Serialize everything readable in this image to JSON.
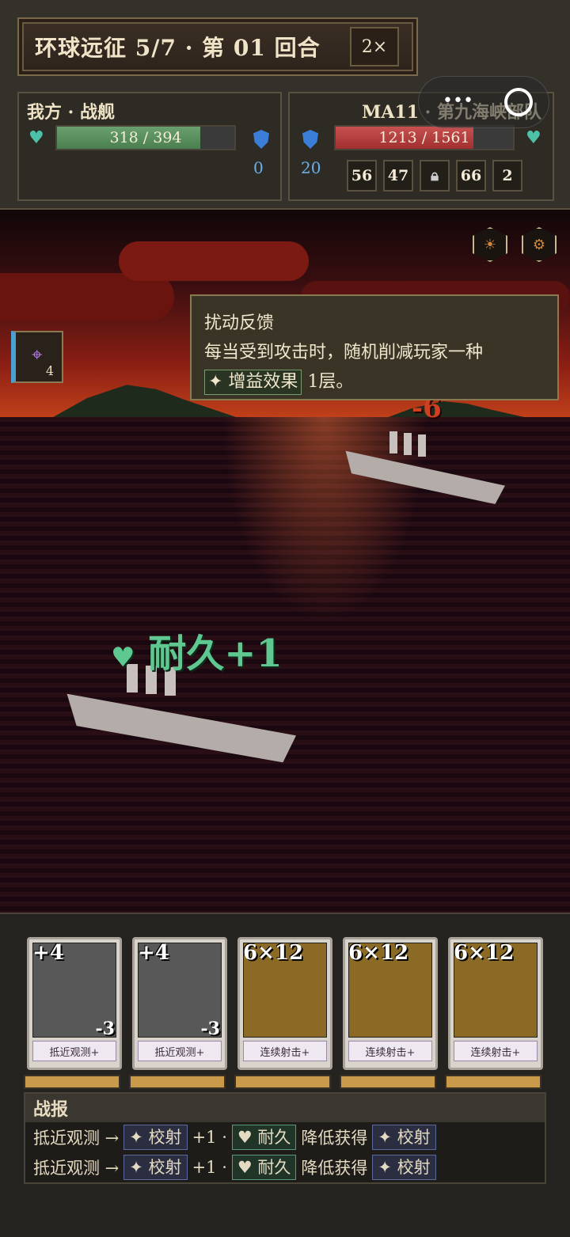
{
  "header": {
    "title": "环球远征 5/7 · 第 01 回合",
    "speed": "2×"
  },
  "player": {
    "name": "我方 · 战舰",
    "hp_text": "318 / 394",
    "hp_fraction": 0.807,
    "shield": "0"
  },
  "enemy": {
    "name": "MA11 · 第九海峡部队",
    "hp_text": "1213 / 1561",
    "hp_fraction": 0.777,
    "shield": "20",
    "stats": [
      "56",
      "47",
      "",
      "66",
      "2"
    ]
  },
  "tooltip": {
    "title": "扰动反馈",
    "line1": "每当受到攻击时，随机削减玩家一种",
    "tag": "✦ 增益效果",
    "suffix": "1层。"
  },
  "buff": {
    "count": "4"
  },
  "float_text": "耐久+1",
  "damage_text": "-6",
  "cards": [
    {
      "cost": "+4",
      "name": "抵近观测+",
      "minus": "-3"
    },
    {
      "cost": "+4",
      "name": "抵近观测+",
      "minus": "-3"
    },
    {
      "cost": "6×12",
      "name": "连续射击+",
      "minus": ""
    },
    {
      "cost": "6×12",
      "name": "连续射击+",
      "minus": ""
    },
    {
      "cost": "6×12",
      "name": "连续射击+",
      "minus": ""
    }
  ],
  "report": {
    "title": "战报",
    "lines": [
      {
        "src": "抵近观测 →",
        "a": "✦ 校射",
        "b": "+1 ·",
        "c": "♥ 耐久",
        "d": "降低获得",
        "e": "✦ 校射"
      },
      {
        "src": "抵近观测 →",
        "a": "✦ 校射",
        "b": "+1 ·",
        "c": "♥ 耐久",
        "d": "降低获得",
        "e": "✦ 校射"
      }
    ]
  }
}
